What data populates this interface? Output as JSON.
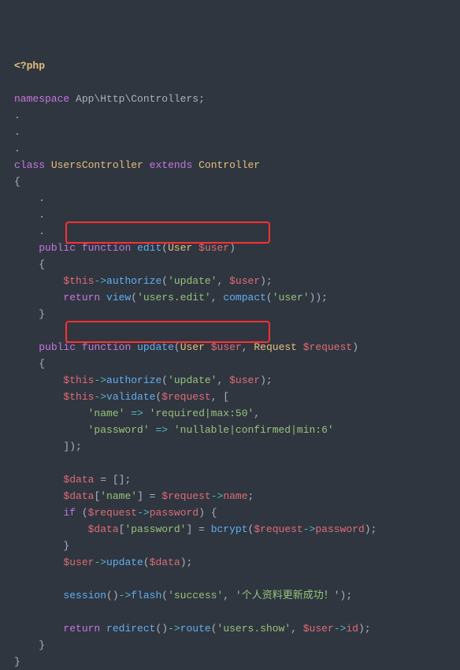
{
  "code": {
    "phpOpen": "<?php",
    "ns_kw": "namespace",
    "ns_val": "App\\Http\\Controllers",
    "class_kw": "class",
    "class_name": "UsersController",
    "extends_kw": "extends",
    "parent_class": "Controller",
    "public_kw": "public",
    "function_kw": "function",
    "edit_fn": "edit",
    "update_fn": "update",
    "user_type": "User",
    "request_type": "Request",
    "user_var": "$user",
    "this_var": "$this",
    "request_var": "$request",
    "data_var": "$data",
    "authorize_fn": "authorize",
    "view_fn": "view",
    "compact_fn": "compact",
    "validate_fn": "validate",
    "bcrypt_fn": "bcrypt",
    "session_fn": "session",
    "flash_fn": "flash",
    "redirect_fn": "redirect",
    "route_fn": "route",
    "update_method": "update",
    "return_kw": "return",
    "if_kw": "if",
    "arrow": "->",
    "fat_arrow": "=>",
    "str_update": "'update'",
    "str_users_edit": "'users.edit'",
    "str_user": "'user'",
    "str_name": "'name'",
    "str_name_rule": "'required|max:50'",
    "str_password": "'password'",
    "str_password_rule": "'nullable|confirmed|min:6'",
    "str_success": "'success'",
    "str_success_msg": "'个人资料更新成功！'",
    "str_users_show": "'users.show'",
    "name_prop": "name",
    "password_prop": "password",
    "id_prop": "id",
    "empty_arr": "[]",
    "dot1": ".",
    "dot2": ".",
    "dot3": "."
  }
}
